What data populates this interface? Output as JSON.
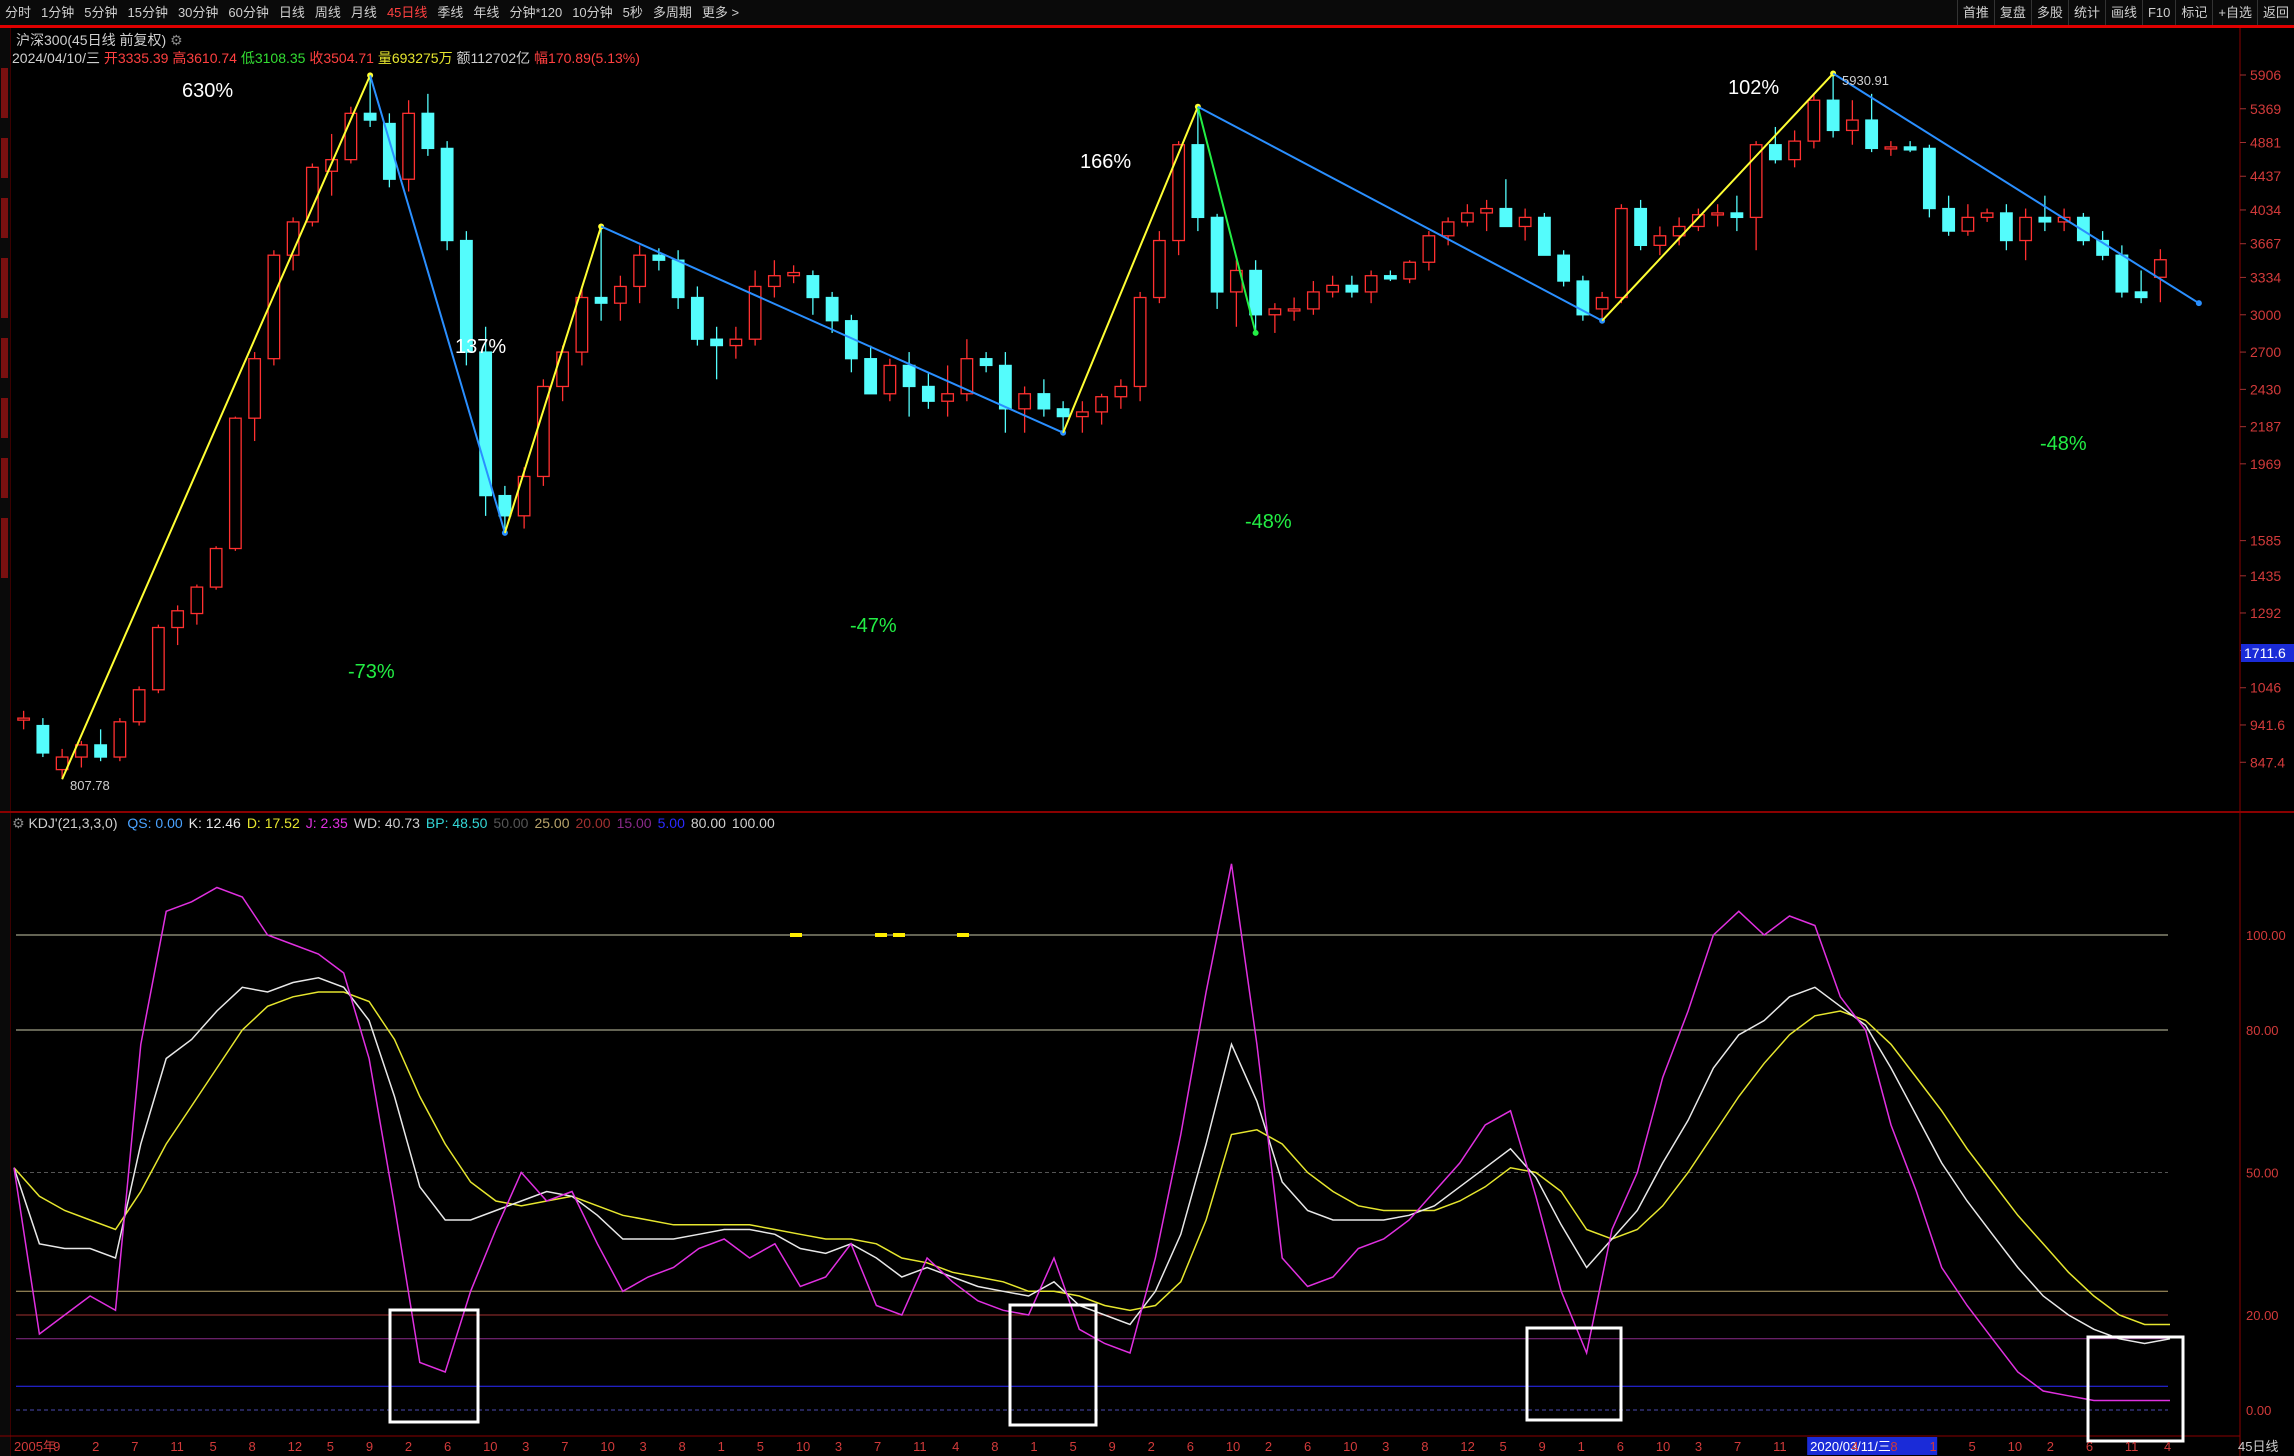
{
  "toolbar": {
    "items": [
      "分时",
      "1分钟",
      "5分钟",
      "15分钟",
      "30分钟",
      "60分钟",
      "日线",
      "周线",
      "月线",
      "45日线",
      "季线",
      "年线",
      "分钟*120",
      "10分钟",
      "5秒",
      "多周期",
      "更多 >"
    ],
    "active_index": 9,
    "right_items": [
      "首推",
      "复盘",
      "多股",
      "统计",
      "画线",
      "F10",
      "标记",
      "+自选",
      "返回"
    ]
  },
  "main_chart": {
    "title": "沪深300(45日线 前复权)",
    "info": {
      "date": "2024/04/10/三",
      "open_label": "开",
      "open": "3335.39",
      "high_label": "高",
      "high": "3610.74",
      "low_label": "低",
      "low": "3108.35",
      "close_label": "收",
      "close": "3504.71",
      "volume_label": "量",
      "volume": "693275万",
      "amount_label": "额",
      "amount": "112702亿",
      "range_label": "幅",
      "range": "170.89(5.13%)"
    },
    "price_axis": [
      "5906",
      "5369",
      "4881",
      "4437",
      "4034",
      "3667",
      "3334",
      "3000",
      "2700",
      "2430",
      "2187",
      "1969",
      "1585",
      "1435",
      "1292",
      "1162",
      "1046",
      "941.6",
      "847.4"
    ],
    "current_price_tag": "1711.6",
    "peak_label": "5930.91",
    "trough_label": "807.78",
    "annotations": [
      {
        "text": "630%",
        "color": "#ffffff"
      },
      {
        "text": "-73%",
        "color": "#22ee44"
      },
      {
        "text": "137%",
        "color": "#ffffff"
      },
      {
        "text": "-47%",
        "color": "#22ee44"
      },
      {
        "text": "166%",
        "color": "#ffffff"
      },
      {
        "text": "-48%",
        "color": "#22ee44"
      },
      {
        "text": "102%",
        "color": "#ffffff"
      },
      {
        "text": "-48%",
        "color": "#22ee44"
      }
    ]
  },
  "kdj_panel": {
    "title": "KDJ'(21,3,3,0)",
    "legend": [
      {
        "label": "QS:",
        "value": "0.00",
        "color": "#4aa3ff"
      },
      {
        "label": "K:",
        "value": "12.46",
        "color": "#e8e8e8"
      },
      {
        "label": "D:",
        "value": "17.52",
        "color": "#e6e62e"
      },
      {
        "label": "J:",
        "value": "2.35",
        "color": "#e030e0"
      },
      {
        "label": "WD:",
        "value": "40.73",
        "color": "#cfcfcf"
      },
      {
        "label": "BP:",
        "value": "48.50",
        "color": "#33d6d6"
      },
      {
        "label": "50.00",
        "value": "",
        "color": "#555555"
      },
      {
        "label": "25.00",
        "value": "",
        "color": "#b8a36a"
      },
      {
        "label": "20.00",
        "value": "",
        "color": "#a03030"
      },
      {
        "label": "15.00",
        "value": "",
        "color": "#8a2a8a"
      },
      {
        "label": "5.00",
        "value": "",
        "color": "#2a2aff"
      },
      {
        "label": "80.00",
        "value": "",
        "color": "#cfcfcf"
      },
      {
        "label": "100.00",
        "value": "",
        "color": "#cfcfcf"
      }
    ],
    "axis": [
      "100.00",
      "80.00",
      "50.00",
      "20.00",
      "0.00"
    ]
  },
  "x_axis": {
    "labels": [
      "2005年",
      "9",
      "2",
      "7",
      "11",
      "5",
      "8",
      "12",
      "5",
      "9",
      "2",
      "6",
      "10",
      "3",
      "7",
      "10",
      "3",
      "8",
      "1",
      "5",
      "10",
      "3",
      "7",
      "11",
      "4",
      "8",
      "1",
      "5",
      "9",
      "2",
      "6",
      "10",
      "2",
      "6",
      "10",
      "3",
      "8",
      "12",
      "5",
      "9",
      "1",
      "6",
      "10",
      "3",
      "7",
      "11",
      "2020/03/11/三",
      "4",
      "8",
      "1",
      "5",
      "10",
      "2",
      "6",
      "11",
      "4"
    ],
    "corner_label": "45日线"
  },
  "chart_data": {
    "type": "candlestick",
    "title": "沪深300(45日线 前复权)",
    "interval": "45日线",
    "log_scale": true,
    "ylim": [
      807.78,
      5930.91
    ],
    "candles": [
      [
        960,
        980,
        930,
        960
      ],
      [
        940,
        960,
        860,
        870
      ],
      [
        830,
        880,
        808,
        860
      ],
      [
        860,
        900,
        835,
        890
      ],
      [
        890,
        930,
        850,
        860
      ],
      [
        860,
        960,
        850,
        950
      ],
      [
        950,
        1050,
        940,
        1040
      ],
      [
        1040,
        1250,
        1030,
        1240
      ],
      [
        1240,
        1320,
        1180,
        1300
      ],
      [
        1290,
        1400,
        1250,
        1390
      ],
      [
        1390,
        1560,
        1380,
        1550
      ],
      [
        1550,
        2250,
        1540,
        2240
      ],
      [
        2240,
        2700,
        2100,
        2650
      ],
      [
        2650,
        3600,
        2600,
        3550
      ],
      [
        3550,
        3950,
        3400,
        3900
      ],
      [
        3900,
        4600,
        3850,
        4550
      ],
      [
        4500,
        5000,
        4200,
        4650
      ],
      [
        4650,
        5400,
        4600,
        5300
      ],
      [
        5300,
        5900,
        5100,
        5200
      ],
      [
        5150,
        5300,
        4300,
        4400
      ],
      [
        4400,
        5500,
        4250,
        5300
      ],
      [
        5300,
        5600,
        4700,
        4800
      ],
      [
        4800,
        4900,
        3600,
        3700
      ],
      [
        3700,
        3800,
        2600,
        2700
      ],
      [
        2700,
        2900,
        1700,
        1800
      ],
      [
        1800,
        1850,
        1620,
        1700
      ],
      [
        1700,
        1950,
        1640,
        1900
      ],
      [
        1900,
        2500,
        1850,
        2450
      ],
      [
        2450,
        2750,
        2350,
        2700
      ],
      [
        2700,
        3250,
        2600,
        3150
      ],
      [
        3150,
        3850,
        2950,
        3100
      ],
      [
        3100,
        3350,
        2950,
        3250
      ],
      [
        3250,
        3650,
        3100,
        3550
      ],
      [
        3550,
        3620,
        3400,
        3500
      ],
      [
        3500,
        3600,
        3050,
        3150
      ],
      [
        3150,
        3250,
        2750,
        2800
      ],
      [
        2800,
        2900,
        2500,
        2750
      ],
      [
        2750,
        2900,
        2650,
        2800
      ],
      [
        2800,
        3400,
        2750,
        3250
      ],
      [
        3250,
        3500,
        3150,
        3350
      ],
      [
        3350,
        3450,
        3280,
        3380
      ],
      [
        3350,
        3400,
        3000,
        3150
      ],
      [
        3150,
        3200,
        2850,
        2950
      ],
      [
        2950,
        3000,
        2550,
        2650
      ],
      [
        2650,
        2750,
        2450,
        2400
      ],
      [
        2400,
        2650,
        2350,
        2600
      ],
      [
        2600,
        2700,
        2250,
        2450
      ],
      [
        2450,
        2550,
        2300,
        2350
      ],
      [
        2350,
        2600,
        2250,
        2400
      ],
      [
        2400,
        2800,
        2350,
        2650
      ],
      [
        2650,
        2700,
        2550,
        2600
      ],
      [
        2600,
        2700,
        2150,
        2300
      ],
      [
        2300,
        2450,
        2150,
        2400
      ],
      [
        2400,
        2500,
        2250,
        2300
      ],
      [
        2300,
        2350,
        2150,
        2250
      ],
      [
        2250,
        2350,
        2150,
        2280
      ],
      [
        2280,
        2400,
        2200,
        2380
      ],
      [
        2380,
        2500,
        2300,
        2450
      ],
      [
        2450,
        3200,
        2350,
        3150
      ],
      [
        3150,
        3800,
        3100,
        3700
      ],
      [
        3700,
        4900,
        3550,
        4850
      ],
      [
        4850,
        5400,
        3800,
        3950
      ],
      [
        3950,
        3990,
        3050,
        3200
      ],
      [
        3200,
        3500,
        2900,
        3400
      ],
      [
        3400,
        3500,
        2850,
        3000
      ],
      [
        3000,
        3100,
        2850,
        3050
      ],
      [
        3050,
        3150,
        2950,
        3050
      ],
      [
        3050,
        3300,
        3000,
        3200
      ],
      [
        3200,
        3350,
        3150,
        3260
      ],
      [
        3260,
        3350,
        3150,
        3200
      ],
      [
        3200,
        3400,
        3100,
        3350
      ],
      [
        3350,
        3400,
        3300,
        3320
      ],
      [
        3320,
        3500,
        3280,
        3480
      ],
      [
        3480,
        3800,
        3400,
        3750
      ],
      [
        3750,
        3950,
        3650,
        3900
      ],
      [
        3900,
        4100,
        3850,
        4000
      ],
      [
        4000,
        4150,
        3800,
        4050
      ],
      [
        4050,
        4400,
        3900,
        3850
      ],
      [
        3850,
        4050,
        3700,
        3950
      ],
      [
        3950,
        4000,
        3550,
        3550
      ],
      [
        3550,
        3600,
        3250,
        3300
      ],
      [
        3300,
        3350,
        2950,
        3000
      ],
      [
        3050,
        3200,
        2950,
        3150
      ],
      [
        3150,
        4100,
        3100,
        4050
      ],
      [
        4050,
        4150,
        3600,
        3650
      ],
      [
        3650,
        3850,
        3550,
        3750
      ],
      [
        3750,
        3950,
        3650,
        3850
      ],
      [
        3850,
        4050,
        3800,
        3980
      ],
      [
        3980,
        4100,
        3850,
        4000
      ],
      [
        4000,
        4200,
        3800,
        3950
      ],
      [
        3950,
        4900,
        3600,
        4850
      ],
      [
        4850,
        5100,
        4600,
        4650
      ],
      [
        4650,
        5050,
        4550,
        4900
      ],
      [
        4900,
        5600,
        4800,
        5500
      ],
      [
        5500,
        5930.91,
        4950,
        5050
      ],
      [
        5050,
        5500,
        4850,
        5200
      ],
      [
        5200,
        5600,
        4750,
        4800
      ],
      [
        4800,
        4900,
        4700,
        4820
      ],
      [
        4820,
        4900,
        4750,
        4780
      ],
      [
        4800,
        4850,
        3950,
        4050
      ],
      [
        4050,
        4200,
        3750,
        3800
      ],
      [
        3800,
        4100,
        3750,
        3950
      ],
      [
        3950,
        4050,
        3900,
        4000
      ],
      [
        4000,
        4100,
        3600,
        3700
      ],
      [
        3700,
        4050,
        3500,
        3950
      ],
      [
        3950,
        4200,
        3800,
        3900
      ],
      [
        3900,
        4050,
        3800,
        3950
      ],
      [
        3950,
        4000,
        3650,
        3700
      ],
      [
        3700,
        3800,
        3500,
        3550
      ],
      [
        3550,
        3650,
        3150,
        3200
      ],
      [
        3200,
        3400,
        3100,
        3150
      ],
      [
        3335.39,
        3610.74,
        3108.35,
        3504.71
      ]
    ],
    "zigzag": [
      {
        "from": [
          2,
          807.78
        ],
        "to": [
          18,
          5900
        ],
        "color": "#ffff33",
        "label": "630%"
      },
      {
        "from": [
          18,
          5900
        ],
        "to": [
          25,
          1620
        ],
        "color": "#2a8fff",
        "label": "-73%"
      },
      {
        "from": [
          25,
          1620
        ],
        "to": [
          30,
          3850
        ],
        "color": "#ffff33",
        "label": "137%"
      },
      {
        "from": [
          30,
          3850
        ],
        "to": [
          54,
          2150
        ],
        "color": "#2a8fff",
        "label": "-47%"
      },
      {
        "from": [
          54,
          2150
        ],
        "to": [
          61,
          5400
        ],
        "color": "#ffff33",
        "label": "166%"
      },
      {
        "from": [
          61,
          5400
        ],
        "to": [
          64,
          2850
        ],
        "color": "#22ee44",
        "label": "-48%"
      },
      {
        "from": [
          61,
          5400
        ],
        "to": [
          82,
          2950
        ],
        "color": "#2a8fff",
        "label": ""
      },
      {
        "from": [
          82,
          2950
        ],
        "to": [
          94,
          5930.91
        ],
        "color": "#ffff33",
        "label": "102%"
      },
      {
        "from": [
          94,
          5930.91
        ],
        "to": [
          113,
          3100
        ],
        "color": "#2a8fff",
        "label": "-48%"
      }
    ],
    "kdj": {
      "K": [
        51,
        35,
        34,
        34,
        32,
        56,
        74,
        78,
        84,
        89,
        88,
        90,
        91,
        89,
        82,
        66,
        47,
        40,
        40,
        42,
        44,
        46,
        45,
        41,
        36,
        36,
        36,
        37,
        38,
        38,
        37,
        34,
        33,
        35,
        32,
        28,
        30,
        28,
        26,
        25,
        24,
        27,
        22,
        20,
        18,
        25,
        37,
        56,
        77,
        65,
        48,
        42,
        40,
        40,
        40,
        41,
        43,
        47,
        51,
        55,
        49,
        39,
        30,
        36,
        42,
        52,
        61,
        72,
        79,
        82,
        87,
        89,
        85,
        81,
        72,
        62,
        52,
        44,
        37,
        30,
        24,
        20,
        17,
        15,
        14,
        15
      ],
      "D": [
        51,
        45,
        42,
        40,
        38,
        46,
        56,
        64,
        72,
        80,
        85,
        87,
        88,
        88,
        86,
        78,
        66,
        56,
        48,
        44,
        43,
        44,
        45,
        43,
        41,
        40,
        39,
        39,
        39,
        39,
        38,
        37,
        36,
        36,
        35,
        32,
        31,
        29,
        28,
        27,
        25,
        25,
        24,
        22,
        21,
        22,
        27,
        40,
        58,
        59,
        56,
        50,
        46,
        43,
        42,
        42,
        42,
        44,
        47,
        51,
        50,
        46,
        38,
        36,
        38,
        43,
        50,
        58,
        66,
        73,
        79,
        83,
        84,
        82,
        77,
        70,
        63,
        55,
        48,
        41,
        35,
        29,
        24,
        20,
        18,
        18
      ],
      "J": [
        51,
        16,
        20,
        24,
        21,
        77,
        105,
        107,
        110,
        108,
        100,
        98,
        96,
        92,
        74,
        43,
        10,
        8,
        25,
        38,
        50,
        44,
        46,
        35,
        25,
        28,
        30,
        34,
        36,
        32,
        35,
        26,
        28,
        35,
        22,
        20,
        32,
        27,
        23,
        21,
        20,
        32,
        17,
        14,
        12,
        32,
        58,
        88,
        115,
        77,
        32,
        26,
        28,
        34,
        36,
        40,
        46,
        52,
        60,
        63,
        45,
        25,
        12,
        38,
        50,
        70,
        84,
        100,
        105,
        100,
        104,
        102,
        87,
        80,
        60,
        46,
        30,
        22,
        15,
        8,
        4,
        3,
        2,
        2,
        2,
        2
      ]
    }
  }
}
